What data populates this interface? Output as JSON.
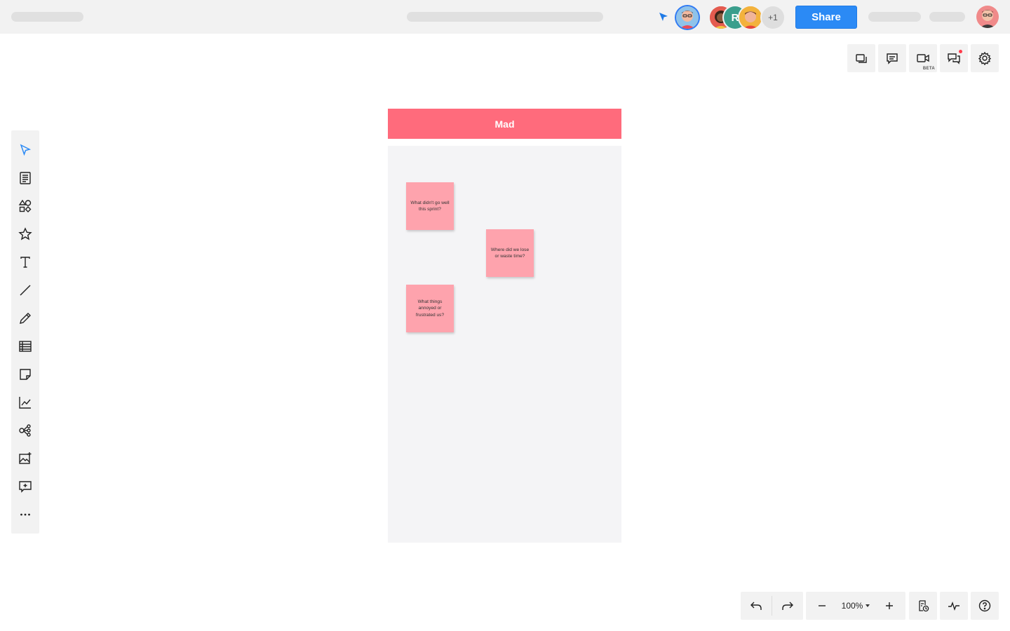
{
  "topbar": {
    "share_label": "Share",
    "extra_collaborators": "+1",
    "collaborator_initial": "R"
  },
  "right_tools": [
    {
      "name": "layers-icon"
    },
    {
      "name": "comment-icon"
    },
    {
      "name": "video-icon",
      "badge": "BETA"
    },
    {
      "name": "chat-icon"
    },
    {
      "name": "gear-icon"
    }
  ],
  "left_tools": [
    "pointer-icon",
    "document-icon",
    "shapes-icon",
    "star-icon",
    "text-icon",
    "line-icon",
    "pencil-icon",
    "table-icon",
    "sticky-note-icon",
    "chart-icon",
    "mindmap-icon",
    "image-icon",
    "add-comment-icon",
    "more-icon"
  ],
  "board": {
    "title": "Mad",
    "stickies": [
      {
        "text": "What didn't go well this sprint?"
      },
      {
        "text": "Where did we lose or waste time?"
      },
      {
        "text": "What things annoyed or frustrated us?"
      }
    ]
  },
  "bottom": {
    "zoom": "100%"
  },
  "colors": {
    "accent": "#2b8af5",
    "board_header": "#ff6b7c",
    "sticky": "#fea3ad",
    "board_bg": "#f4f4f6"
  }
}
